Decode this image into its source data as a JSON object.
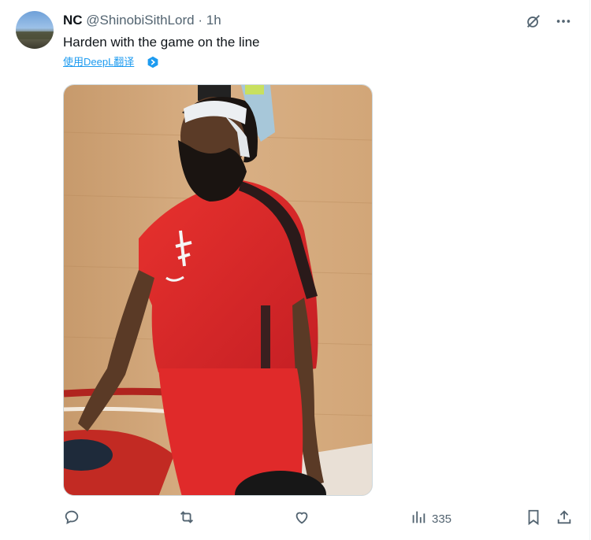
{
  "tweet": {
    "author_name": "NC",
    "author_handle": "@ShinobiSithLord",
    "separator": "·",
    "time": "1h",
    "text": "Harden with the game on the line",
    "translate_label": "使用DeepL翻译"
  },
  "media": {
    "alt": "Basketball player in red warm-up shirt and white headband on court"
  },
  "actions": {
    "views_count": "335"
  },
  "icons": {
    "top": [
      "grok-icon",
      "more-icon"
    ],
    "actions": [
      "reply-icon",
      "retweet-icon",
      "like-icon",
      "views-icon",
      "bookmark-icon",
      "share-icon"
    ]
  },
  "colors": {
    "accent": "#1d9bf0",
    "muted": "#536471",
    "text": "#0f1419",
    "jersey": "#e0262c"
  }
}
